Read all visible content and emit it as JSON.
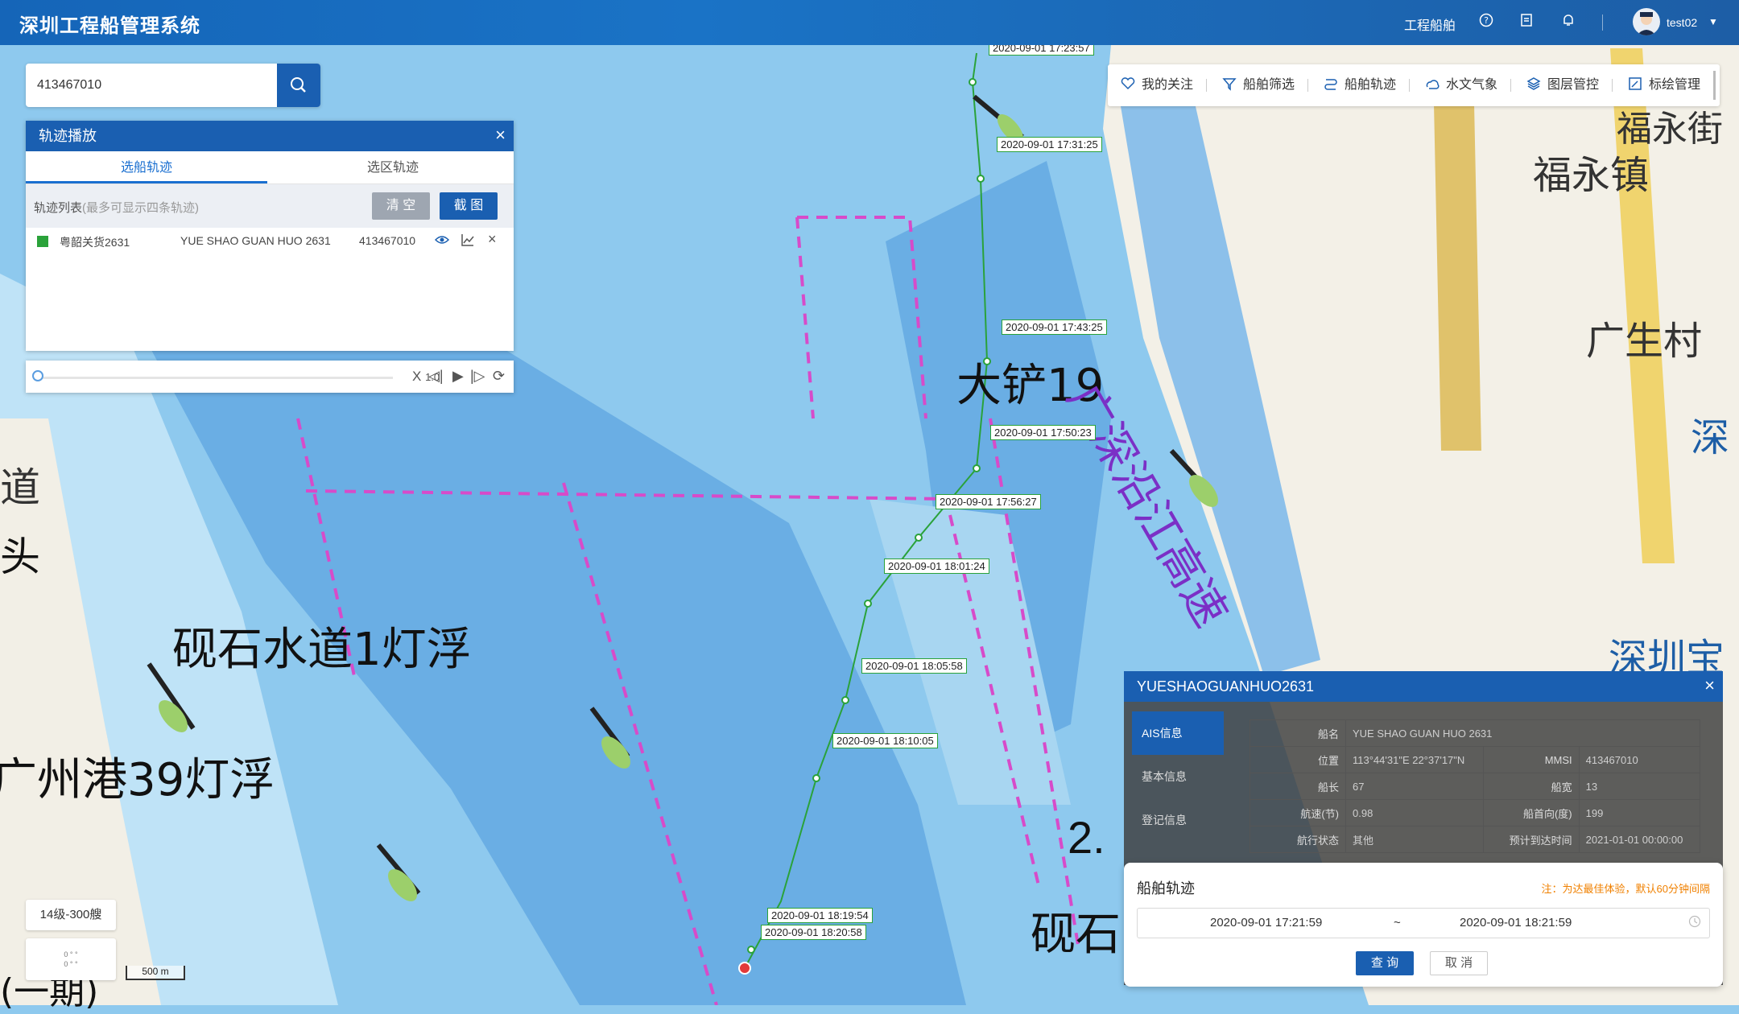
{
  "app": {
    "title": "深圳工程船管理系统"
  },
  "topbar": {
    "link": "工程船舶",
    "user": "test02"
  },
  "search": {
    "value": "413467010"
  },
  "toolbar": {
    "items": [
      "我的关注",
      "船舶筛选",
      "船舶轨迹",
      "水文气象",
      "图层管控",
      "标绘管理"
    ]
  },
  "track_panel": {
    "title": "轨迹播放",
    "tabs": [
      "选船轨迹",
      "选区轨迹"
    ],
    "active_tab": "选船轨迹",
    "list_title": "轨迹列表",
    "list_hint": "(最多可显示四条轨迹)",
    "clear_label": "清 空",
    "shot_label": "截 图",
    "rows": [
      {
        "name_cn": "粤韶关货2631",
        "name_en": "YUE SHAO GUAN HUO 2631",
        "mmsi": "413467010",
        "color": "#2aa23a"
      }
    ]
  },
  "player": {
    "speed": "1.0",
    "speed_prefix": "X",
    "progress": 0
  },
  "map": {
    "labels": [
      "砚石水道1灯浮",
      "广州港39灯浮",
      "大铲19",
      "广深沿江高速",
      "福永镇",
      "广生村",
      "深圳宝",
      "福永街",
      "2.",
      "砚石",
      "道",
      "头",
      "深",
      "(一期)"
    ],
    "track_points": [
      {
        "time": "2020-09-01 17:23:57"
      },
      {
        "time": "2020-09-01 17:31:25"
      },
      {
        "time": "2020-09-01 17:43:25"
      },
      {
        "time": "2020-09-01 17:50:23"
      },
      {
        "time": "2020-09-01 17:56:27"
      },
      {
        "time": "2020-09-01 18:01:24"
      },
      {
        "time": "2020-09-01 18:05:58"
      },
      {
        "time": "2020-09-01 18:10:05"
      },
      {
        "time": "2020-09-01 18:19:54"
      },
      {
        "time": "2020-09-01 18:20:58"
      }
    ],
    "zoom_label": "14级-300艘",
    "scale_label": "500 m",
    "colors": {
      "water": "#8ec9ee",
      "shallow": "#a8d6f1",
      "deep": "#6aaee4",
      "channel": "#d74bc9",
      "track": "#2aa23a"
    }
  },
  "ais_panel": {
    "title": "YUESHAOGUANHUO2631",
    "tabs": [
      "AIS信息",
      "基本信息",
      "登记信息"
    ],
    "active_tab": "AIS信息",
    "rows": [
      {
        "k1": "船名",
        "v1": "YUE SHAO GUAN HUO 2631",
        "k2": "",
        "v2": ""
      },
      {
        "k1": "位置",
        "v1": "113°44'31\"E  22°37'17\"N",
        "k2": "MMSI",
        "v2": "413467010"
      },
      {
        "k1": "船长",
        "v1": "67",
        "k2": "船宽",
        "v2": "13"
      },
      {
        "k1": "航速(节)",
        "v1": "0.98",
        "k2": "船首向(度)",
        "v2": "199"
      },
      {
        "k1": "航行状态",
        "v1": "其他",
        "k2": "预计到达时间",
        "v2": "2021-01-01 00:00:00"
      }
    ]
  },
  "trajectory_query": {
    "title": "船舶轨迹",
    "note": "注：为达最佳体验，默认60分钟间隔",
    "start": "2020-09-01 17:21:59",
    "sep": "~",
    "end": "2020-09-01 18:21:59",
    "query_label": "查 询",
    "cancel_label": "取 消"
  }
}
